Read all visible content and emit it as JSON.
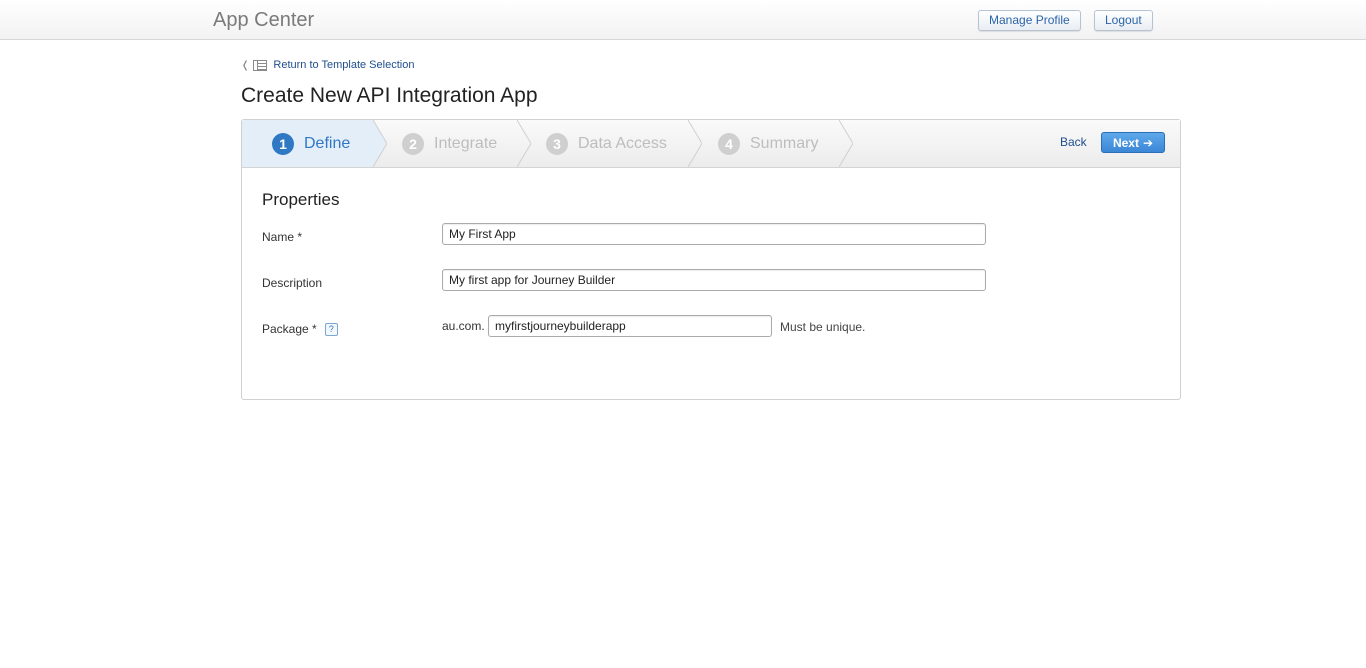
{
  "header": {
    "app_title": "App Center",
    "manage_profile_label": "Manage Profile",
    "logout_label": "Logout"
  },
  "breadcrumb": {
    "return_label": "Return to Template Selection"
  },
  "page": {
    "title": "Create New API Integration App"
  },
  "wizard": {
    "steps": [
      {
        "number": "1",
        "label": "Define",
        "active": true
      },
      {
        "number": "2",
        "label": "Integrate",
        "active": false
      },
      {
        "number": "3",
        "label": "Data Access",
        "active": false
      },
      {
        "number": "4",
        "label": "Summary",
        "active": false
      }
    ],
    "back_label": "Back",
    "next_label": "Next"
  },
  "form": {
    "section_title": "Properties",
    "name": {
      "label": "Name *",
      "value": "My First App"
    },
    "description": {
      "label": "Description",
      "value": "My first app for Journey Builder"
    },
    "package": {
      "label": "Package *",
      "help": "?",
      "prefix": "au.com.",
      "value": "myfirstjourneybuilderapp",
      "hint": "Must be unique."
    }
  },
  "colors": {
    "accent": "#2f78c4",
    "inactive_step": "#bdbdbd"
  }
}
